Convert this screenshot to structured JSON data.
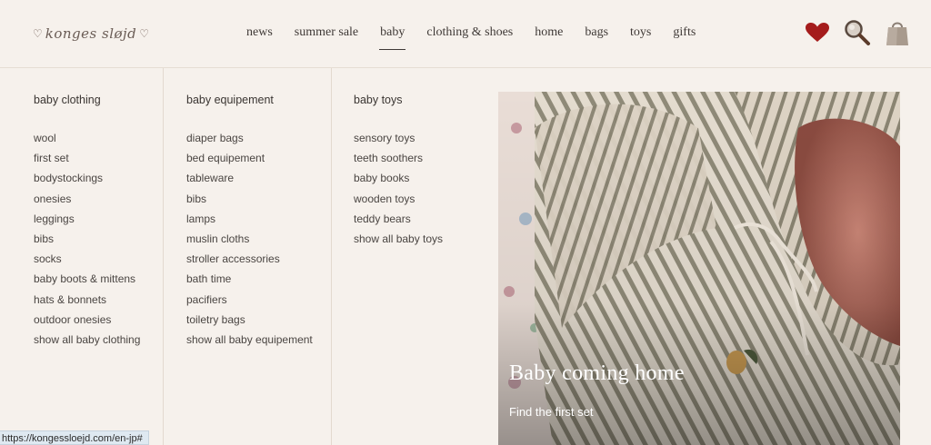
{
  "header": {
    "logo_text": "konges sløjd",
    "nav": [
      {
        "label": "news"
      },
      {
        "label": "summer sale"
      },
      {
        "label": "baby",
        "active": true
      },
      {
        "label": "clothing & shoes"
      },
      {
        "label": "home"
      },
      {
        "label": "bags"
      },
      {
        "label": "toys"
      },
      {
        "label": "gifts"
      }
    ],
    "icons": [
      "heart-icon",
      "search-icon",
      "shopping-bag-icon"
    ],
    "accent_color": "#a51c1c"
  },
  "menu": {
    "columns": [
      {
        "title": "baby clothing",
        "items": [
          "wool",
          "first set",
          "bodystockings",
          "onesies",
          "leggings",
          "bibs",
          "socks",
          "baby boots & mittens",
          "hats & bonnets",
          "outdoor onesies",
          "show all baby clothing"
        ]
      },
      {
        "title": "baby equipement",
        "items": [
          "diaper bags",
          "bed equipement",
          "tableware",
          "bibs",
          "lamps",
          "muslin cloths",
          "stroller accessories",
          "bath time",
          "pacifiers",
          "toiletry bags",
          "show all baby equipement"
        ]
      },
      {
        "title": "baby toys",
        "items": [
          "sensory toys",
          "teeth soothers",
          "baby books",
          "wooden toys",
          "teddy bears",
          "show all baby toys"
        ]
      }
    ],
    "promo": {
      "title": "Baby coming home",
      "link_text": "Find the first set"
    }
  },
  "status_bar": {
    "url": "https://kongessloejd.com/en-jp#"
  }
}
